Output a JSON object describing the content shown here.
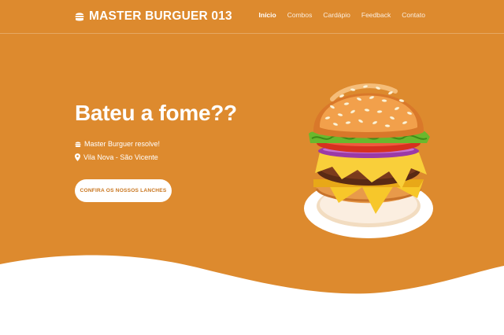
{
  "brand": {
    "name": "MASTER BURGUER 013",
    "icon": "burger-icon"
  },
  "nav": {
    "items": [
      {
        "label": "Início",
        "active": true
      },
      {
        "label": "Combos",
        "active": false
      },
      {
        "label": "Cardápio",
        "active": false
      },
      {
        "label": "Feedback",
        "active": false
      },
      {
        "label": "Contato",
        "active": false
      }
    ]
  },
  "hero": {
    "title": "Bateu a fome??",
    "tagline": "Master Burguer resolve!",
    "location": "Vila Nova - São Vicente",
    "cta_label": "CONFIRA OS NOSSOS LANCHES",
    "image": "burger-illustration"
  },
  "colors": {
    "background": "#dd8a2e",
    "text": "#ffffff",
    "button_text": "#c9761f",
    "footer": "#ffffff"
  }
}
